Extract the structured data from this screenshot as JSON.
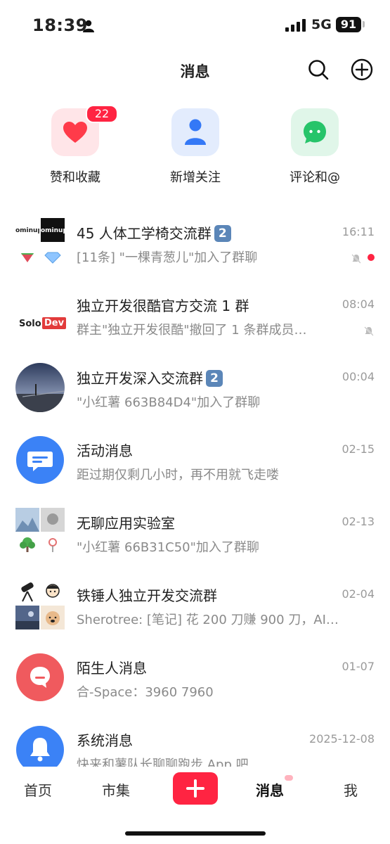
{
  "status_bar": {
    "time": "18:39",
    "network": "5G",
    "battery": "91"
  },
  "header": {
    "title": "消息",
    "search_icon": "search-icon",
    "add_icon": "add-circle-icon"
  },
  "shortcuts": [
    {
      "label": "赞和收藏",
      "icon": "heart-icon",
      "badge": "22",
      "color": "#ff3b4a"
    },
    {
      "label": "新增关注",
      "icon": "person-icon",
      "color": "#3478f6"
    },
    {
      "label": "评论和@",
      "icon": "chat-bubble-icon",
      "color": "#27c46a"
    }
  ],
  "conversations": [
    {
      "title": "45 人体工学椅交流群",
      "badge": "2",
      "subtitle": "[11条] \"一棵青葱儿\"加入了群聊",
      "time": "16:11",
      "muted": true,
      "unread_dot": true,
      "avatar_tiles": [
        "ominup",
        "ominup"
      ]
    },
    {
      "title": "独立开发很酷官方交流 1 群",
      "subtitle": "群主\"独立开发很酷\"撤回了 1 条群成员…",
      "time": "08:04",
      "muted": true,
      "avatar_text_a": "Solo",
      "avatar_text_b": "Dev"
    },
    {
      "title": "独立开发深入交流群",
      "badge": "2",
      "subtitle": "\"小红薯 663B84D4\"加入了群聊",
      "time": "00:04"
    },
    {
      "title": "活动消息",
      "subtitle": "距过期仅剩几小时，再不用就飞走喽",
      "time": "02-15"
    },
    {
      "title": "无聊应用实验室",
      "subtitle": "\"小红薯 66B31C50\"加入了群聊",
      "time": "02-13"
    },
    {
      "title": "铁锤人独立开发交流群",
      "subtitle": "Sherotree: [笔记] 花 200 刀赚 900 刀，AI…",
      "time": "02-04"
    },
    {
      "title": "陌生人消息",
      "subtitle": "合-Space：3960 7960",
      "time": "01-07"
    },
    {
      "title": "系统消息",
      "subtitle": "快来和薯队长聊聊跑步 App 吧",
      "time": "2025-12-08"
    }
  ],
  "tabbar": {
    "home": "首页",
    "market": "市集",
    "messages": "消息",
    "me": "我"
  }
}
